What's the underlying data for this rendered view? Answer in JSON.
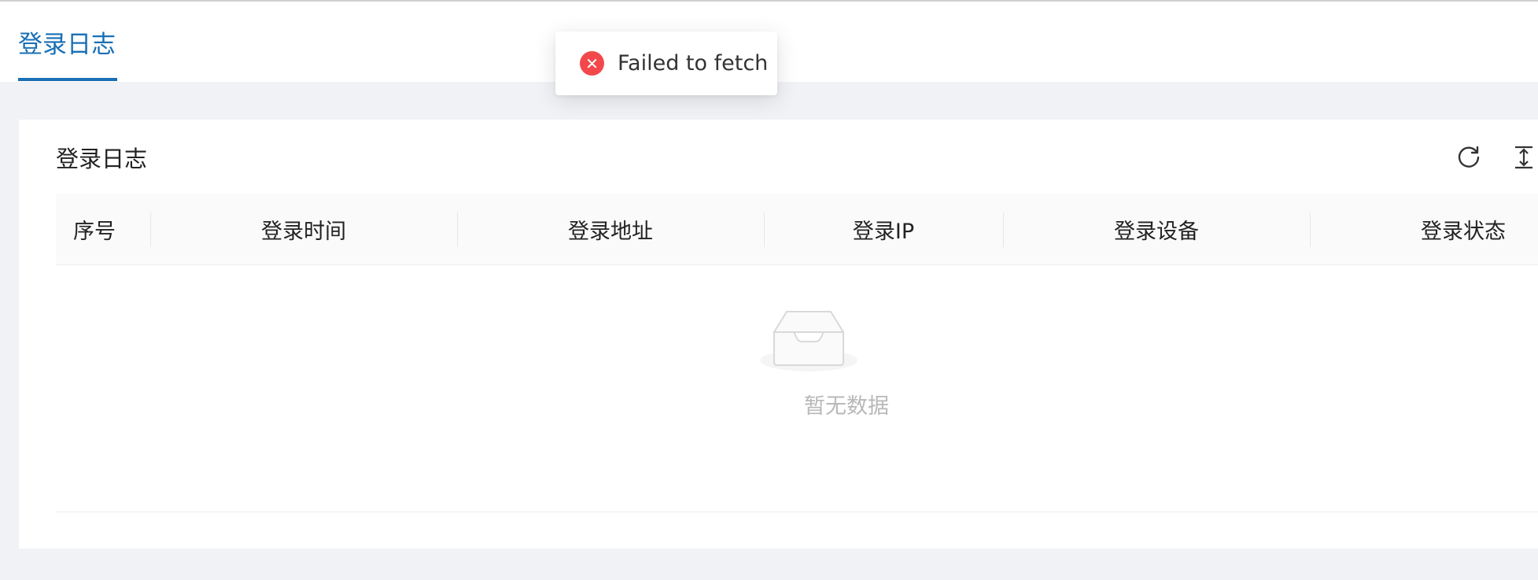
{
  "tab": {
    "label": "登录日志"
  },
  "card": {
    "title": "登录日志"
  },
  "toolbar": {
    "refresh_icon": "refresh-icon",
    "density_icon": "column-height-icon"
  },
  "table": {
    "columns": [
      "序号",
      "登录时间",
      "登录地址",
      "登录IP",
      "登录设备",
      "登录状态"
    ],
    "empty_text": "暂无数据"
  },
  "toast": {
    "type": "error",
    "icon": "close-circle-icon",
    "message": "Failed to fetch"
  },
  "colors": {
    "accent": "#1a6fb5",
    "error": "#f2484b",
    "background": "#f0f2f5"
  }
}
